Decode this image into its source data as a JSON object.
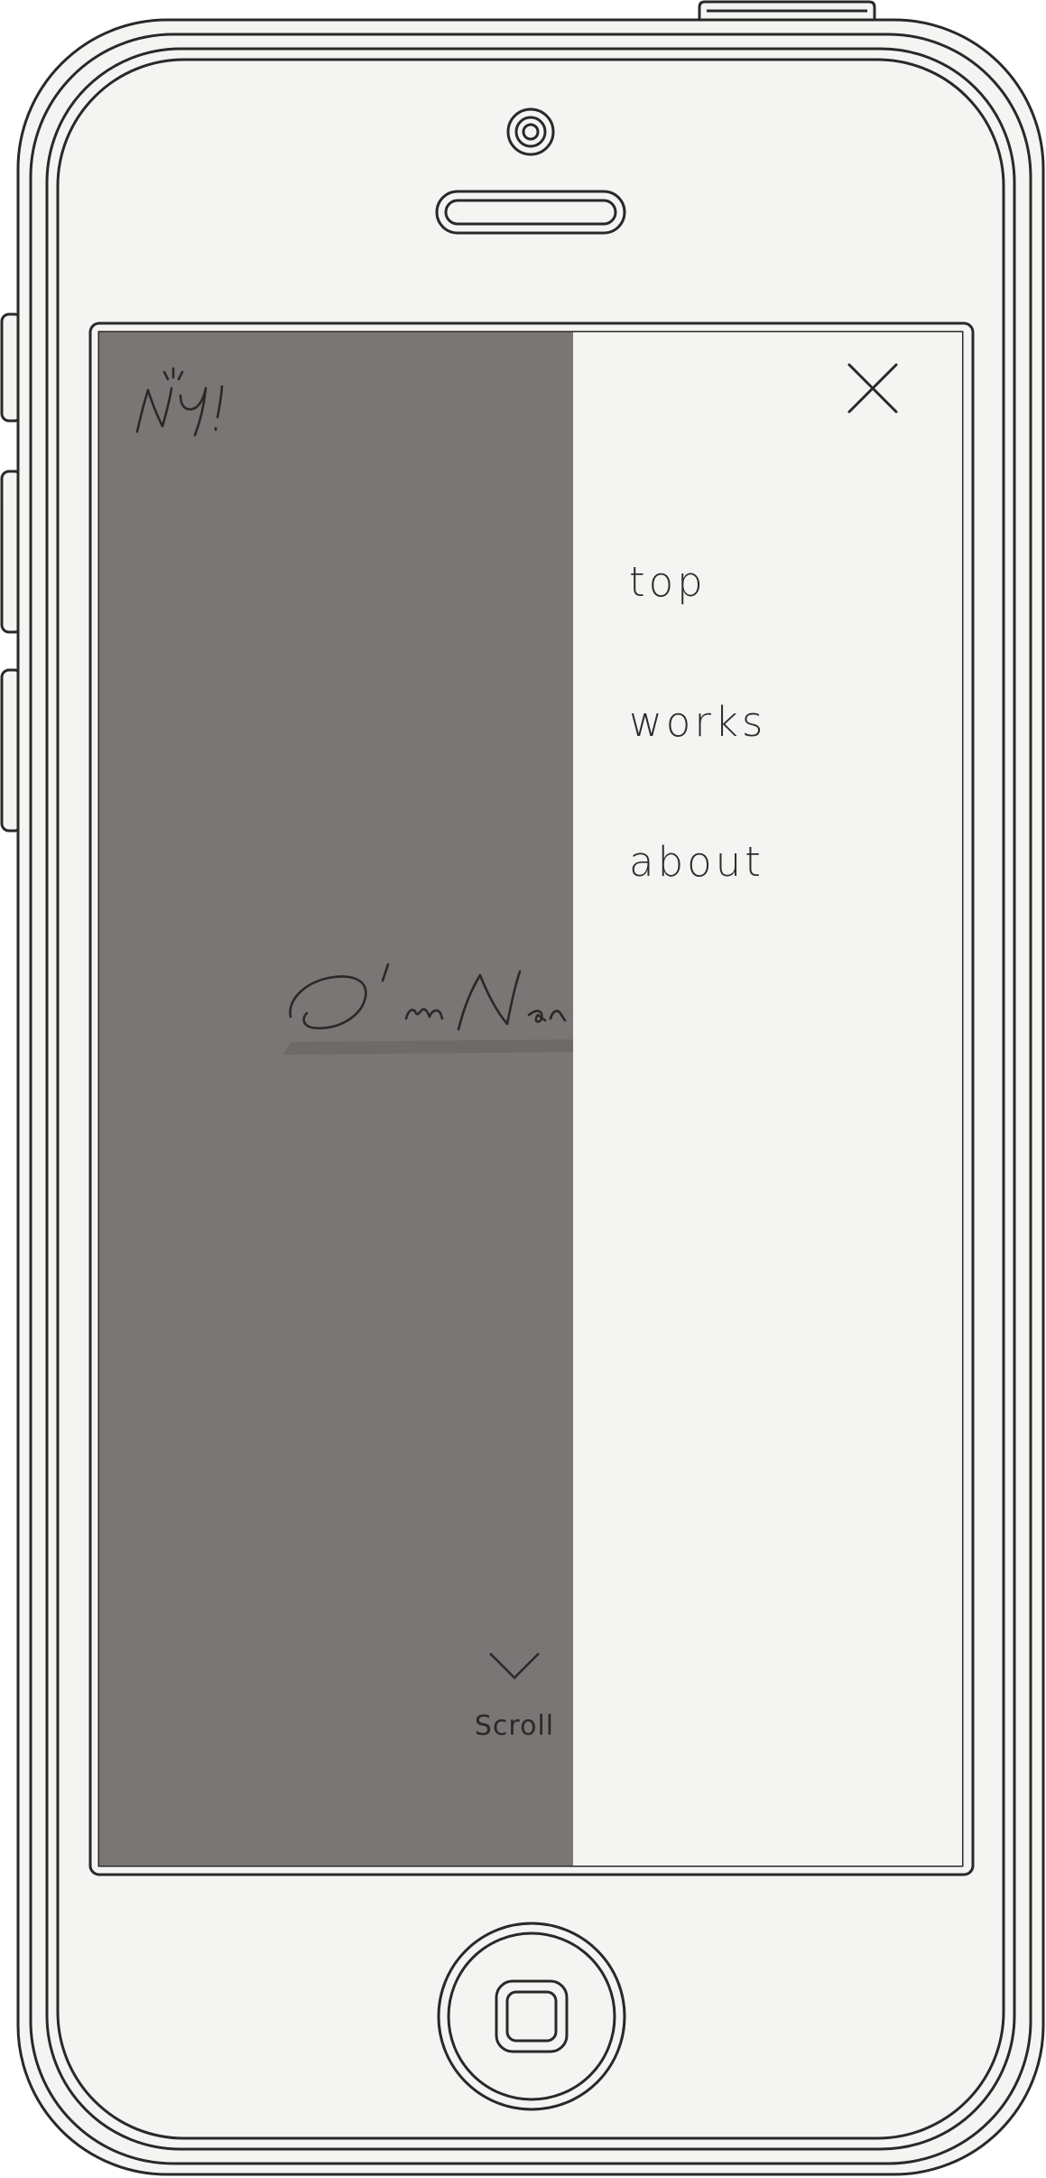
{
  "menu": {
    "items": [
      {
        "label": "top"
      },
      {
        "label": "works"
      },
      {
        "label": "about"
      }
    ]
  },
  "hero": {
    "scroll_label": "Scroll",
    "logo_text": "NY!",
    "signature_text": "I'm Nana"
  },
  "colors": {
    "frame_bg": "#f4f5f3",
    "frame_line": "#2b2828",
    "overlay": "#7a7675",
    "menu_bg": "#f4f5f3",
    "text": "#2f2b2b"
  },
  "icons": {
    "close": "close-icon",
    "scroll": "chevron-down-icon",
    "home": "home-button-icon"
  }
}
